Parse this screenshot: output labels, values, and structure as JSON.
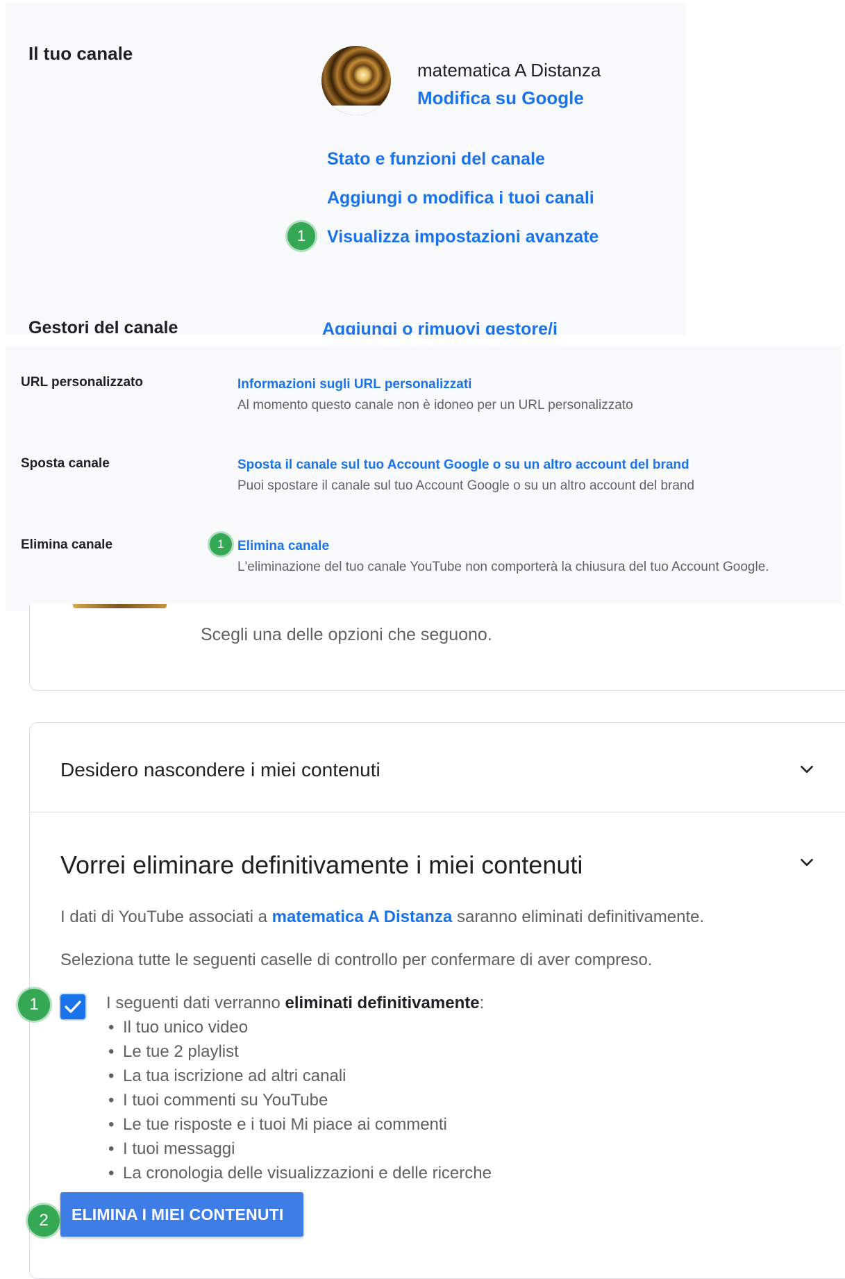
{
  "channel_panel": {
    "section_title": "Il tuo canale",
    "channel_name": "matematica A Distanza",
    "edit_link": "Modifica su Google",
    "links": [
      "Stato e funzioni del canale",
      "Aggiungi o modifica i tuoi canali",
      "Visualizza impostazioni avanzate"
    ],
    "step_badge": "1",
    "managers_label": "Gestori del canale",
    "managers_link": "Aggiungi o rimuovi gestore/i"
  },
  "advanced_panel": {
    "rows": [
      {
        "label": "URL personalizzato",
        "link": "Informazioni sugli URL personalizzati",
        "description": "Al momento questo canale non è idoneo per un URL personalizzato"
      },
      {
        "label": "Sposta canale",
        "link": "Sposta il canale sul tuo Account Google o su un altro account del brand",
        "description": "Puoi spostare il canale sul tuo Account Google o su un altro account del brand"
      },
      {
        "label": "Elimina canale",
        "link": "Elimina canale",
        "description": "L'eliminazione del tuo canale YouTube non comporterà la chiusura del tuo Account Google."
      }
    ],
    "step_badge": "1"
  },
  "delete_dialog": {
    "choose_text": "Scegli una delle opzioni che seguono.",
    "option_hide": "Desidero nascondere i miei contenuti",
    "option_delete": "Vorrei eliminare definitivamente i miei contenuti",
    "info_prefix": "I dati di YouTube associati a",
    "info_channel": "matematica A Distanza",
    "info_suffix": "saranno eliminati definitivamente.",
    "confirm_text": "Seleziona tutte le seguenti caselle di controllo per confermare di aver compreso.",
    "checkbox_checked": true,
    "checkbox_label_prefix": "I seguenti dati verranno",
    "checkbox_label_bold": "eliminati definitivamente",
    "checkbox_label_suffix": ":",
    "bullet": "•",
    "items": [
      "Il tuo unico video",
      "Le tue 2 playlist",
      "La tua iscrizione ad altri canali",
      "I tuoi commenti su YouTube",
      "Le tue risposte e i tuoi Mi piace ai commenti",
      "I tuoi messaggi",
      "La cronologia delle visualizzazioni e delle ricerche"
    ],
    "delete_button": "ELIMINA I MIEI CONTENUTI",
    "step_badge_checkbox": "1",
    "step_badge_button": "2"
  },
  "colors": {
    "link": "#1a73e8",
    "badge": "#34a853",
    "button": "#3e7de6",
    "panel_bg": "#f8f9fa"
  },
  "icons": [
    "chevron-down-icon",
    "check-icon",
    "channel-avatar"
  ]
}
